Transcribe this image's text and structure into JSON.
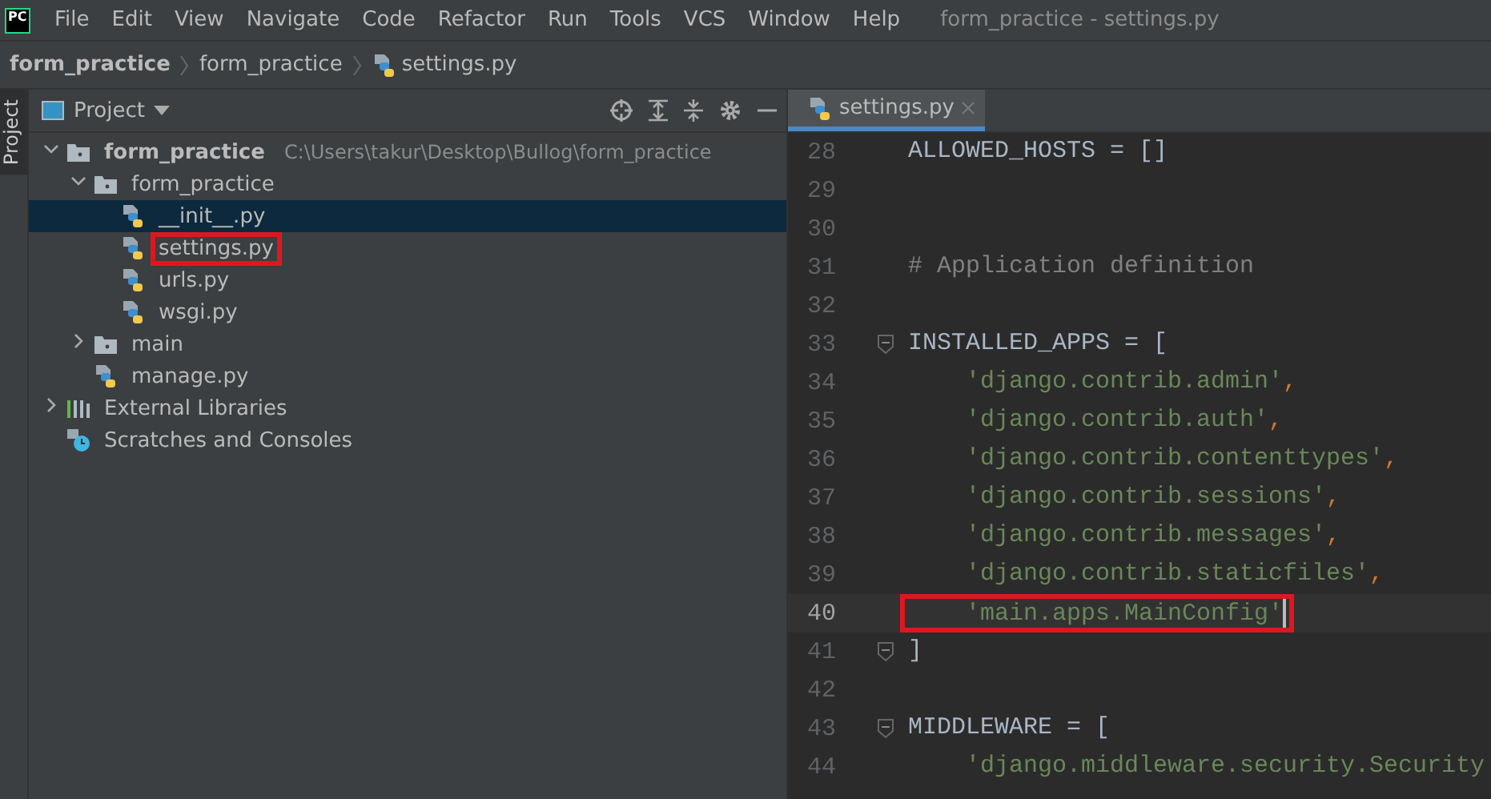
{
  "window": {
    "logo": "PC",
    "title": "form_practice - settings.py"
  },
  "menu": [
    "File",
    "Edit",
    "View",
    "Navigate",
    "Code",
    "Refactor",
    "Run",
    "Tools",
    "VCS",
    "Window",
    "Help"
  ],
  "breadcrumb": [
    {
      "kind": "project",
      "label": "form_practice"
    },
    {
      "kind": "folder",
      "label": "form_practice"
    },
    {
      "kind": "file",
      "label": "settings.py"
    }
  ],
  "tool_strip": {
    "label": "Project"
  },
  "project_panel": {
    "title": "Project",
    "tree": [
      {
        "kind": "folder",
        "label": "form_practice",
        "bold": true,
        "path": "C:\\Users\\takur\\Desktop\\Bullog\\form_practice",
        "expanded": true,
        "selected": false,
        "highlighted": false,
        "children": [
          {
            "kind": "folder",
            "label": "form_practice",
            "expanded": true,
            "selected": false,
            "highlighted": false,
            "children": [
              {
                "kind": "file",
                "label": "__init__.py",
                "selected": true,
                "highlighted": false
              },
              {
                "kind": "file",
                "label": "settings.py",
                "selected": false,
                "highlighted": true
              },
              {
                "kind": "file",
                "label": "urls.py",
                "selected": false,
                "highlighted": false
              },
              {
                "kind": "file",
                "label": "wsgi.py",
                "selected": false,
                "highlighted": false
              }
            ]
          },
          {
            "kind": "folder",
            "label": "main",
            "expanded": false,
            "selected": false,
            "highlighted": false
          },
          {
            "kind": "file",
            "label": "manage.py",
            "selected": false,
            "highlighted": false
          }
        ]
      },
      {
        "kind": "libraries",
        "label": "External Libraries",
        "expanded": false,
        "selected": false,
        "highlighted": false
      },
      {
        "kind": "scratches",
        "label": "Scratches and Consoles",
        "selected": false,
        "highlighted": false
      }
    ]
  },
  "editor": {
    "tabs": [
      {
        "label": "settings.py",
        "selected": true
      }
    ],
    "lines": [
      {
        "number": "28",
        "current": false,
        "fold": false,
        "highlighted": false,
        "tokens": [
          {
            "kind": "name",
            "text": "ALLOWED_HOSTS = []"
          }
        ]
      },
      {
        "number": "29",
        "current": false,
        "fold": false,
        "highlighted": false
      },
      {
        "number": "30",
        "current": false,
        "fold": false,
        "highlighted": false
      },
      {
        "number": "31",
        "current": false,
        "fold": false,
        "highlighted": false,
        "tokens": [
          {
            "kind": "comment",
            "text": "# Application definition"
          }
        ]
      },
      {
        "number": "32",
        "current": false,
        "fold": false,
        "highlighted": false
      },
      {
        "number": "33",
        "current": false,
        "fold": true,
        "highlighted": false,
        "tokens": [
          {
            "kind": "name",
            "text": "INSTALLED_APPS = ["
          }
        ]
      },
      {
        "number": "34",
        "current": false,
        "fold": false,
        "highlighted": false,
        "tokens": [
          {
            "kind": "string",
            "text": "    'django.contrib.admin'"
          },
          {
            "kind": "punct",
            "text": ","
          }
        ]
      },
      {
        "number": "35",
        "current": false,
        "fold": false,
        "highlighted": false,
        "tokens": [
          {
            "kind": "string",
            "text": "    'django.contrib.auth'"
          },
          {
            "kind": "punct",
            "text": ","
          }
        ]
      },
      {
        "number": "36",
        "current": false,
        "fold": false,
        "highlighted": false,
        "tokens": [
          {
            "kind": "string",
            "text": "    'django.contrib.contenttypes'"
          },
          {
            "kind": "punct",
            "text": ","
          }
        ]
      },
      {
        "number": "37",
        "current": false,
        "fold": false,
        "highlighted": false,
        "tokens": [
          {
            "kind": "string",
            "text": "    'django.contrib.sessions'"
          },
          {
            "kind": "punct",
            "text": ","
          }
        ]
      },
      {
        "number": "38",
        "current": false,
        "fold": false,
        "highlighted": false,
        "tokens": [
          {
            "kind": "string",
            "text": "    'django.contrib.messages'"
          },
          {
            "kind": "punct",
            "text": ","
          }
        ]
      },
      {
        "number": "39",
        "current": false,
        "fold": false,
        "highlighted": false,
        "tokens": [
          {
            "kind": "string",
            "text": "    'django.contrib.staticfiles'"
          },
          {
            "kind": "punct",
            "text": ","
          }
        ]
      },
      {
        "number": "40",
        "current": true,
        "fold": false,
        "highlighted": true,
        "tokens": [
          {
            "kind": "string",
            "text": "    'main.apps.MainConfig'"
          }
        ]
      },
      {
        "number": "41",
        "current": false,
        "fold": true,
        "highlighted": false,
        "tokens": [
          {
            "kind": "name",
            "text": "]"
          }
        ]
      },
      {
        "number": "42",
        "current": false,
        "fold": false,
        "highlighted": false
      },
      {
        "number": "43",
        "current": false,
        "fold": true,
        "highlighted": false,
        "tokens": [
          {
            "kind": "name",
            "text": "MIDDLEWARE = ["
          }
        ]
      },
      {
        "number": "44",
        "current": false,
        "fold": false,
        "highlighted": false,
        "tokens": [
          {
            "kind": "string",
            "text": "    'django.middleware.security.Security"
          }
        ]
      }
    ]
  }
}
